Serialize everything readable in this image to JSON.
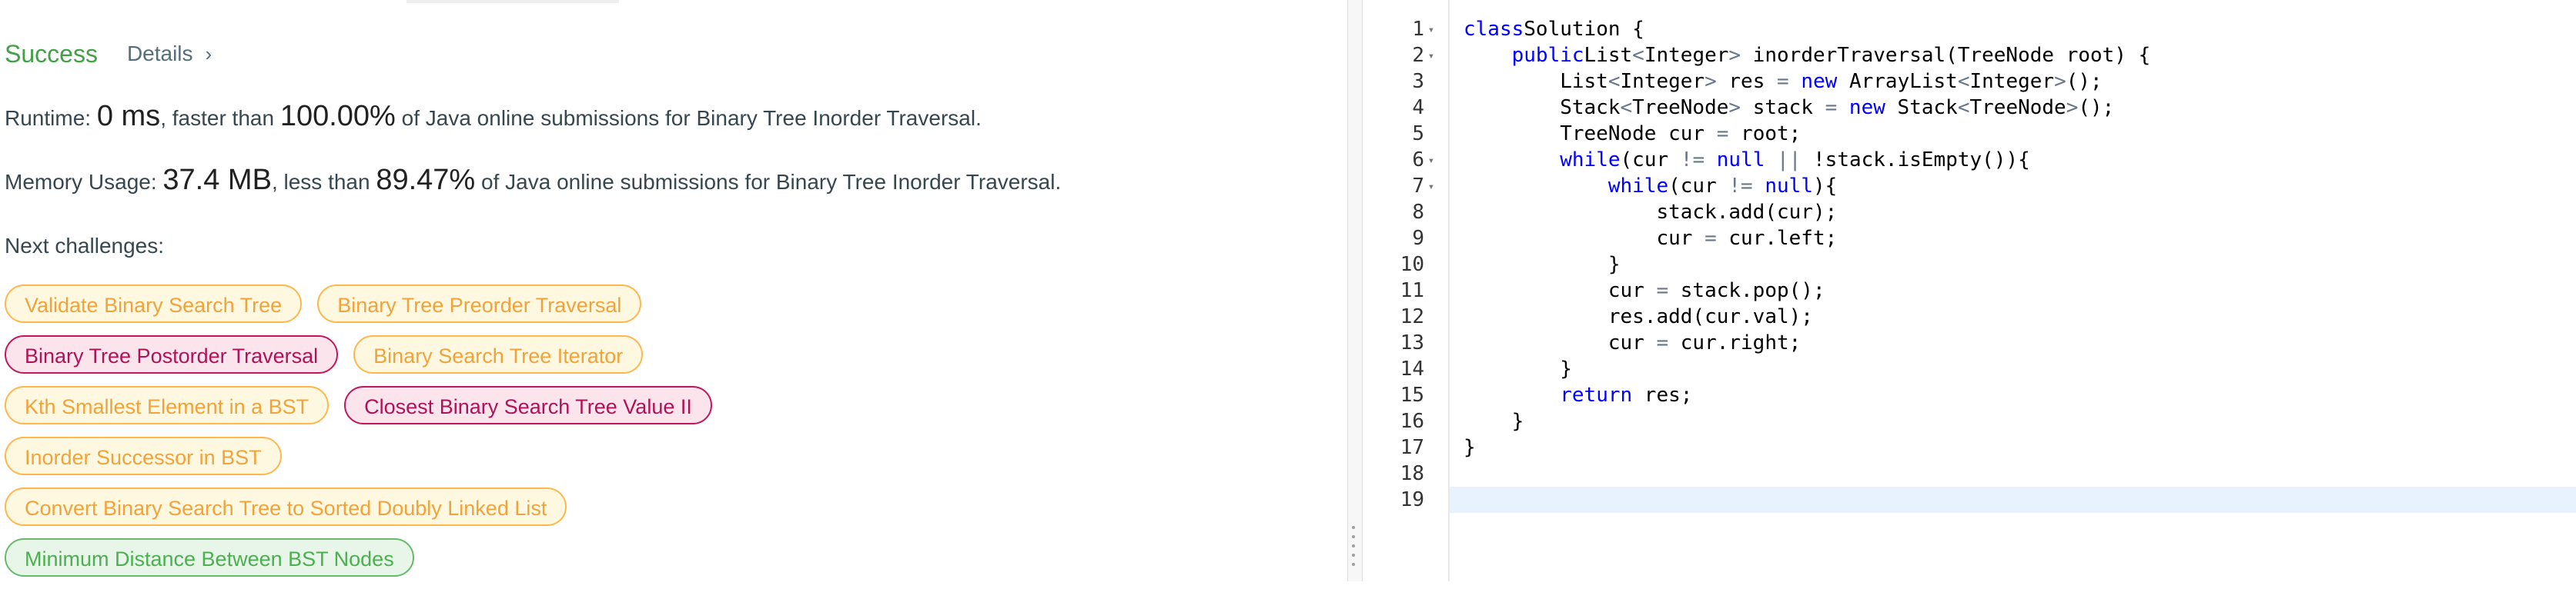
{
  "result": {
    "status": "Success",
    "details_label": "Details",
    "runtime": {
      "label": "Runtime: ",
      "value": "0 ms",
      "comparison": ", faster than ",
      "percent": "100.00%",
      "suffix": " of Java online submissions for Binary Tree Inorder Traversal."
    },
    "memory": {
      "label": "Memory Usage: ",
      "value": "37.4 MB",
      "comparison": ", less than ",
      "percent": "89.47%",
      "suffix": " of Java online submissions for Binary Tree Inorder Traversal."
    }
  },
  "next_challenges": {
    "title": "Next challenges:",
    "rows": [
      [
        {
          "label": "Validate Binary Search Tree",
          "difficulty": "medium"
        },
        {
          "label": "Binary Tree Preorder Traversal",
          "difficulty": "medium"
        }
      ],
      [
        {
          "label": "Binary Tree Postorder Traversal",
          "difficulty": "hard"
        },
        {
          "label": "Binary Search Tree Iterator",
          "difficulty": "medium"
        }
      ],
      [
        {
          "label": "Kth Smallest Element in a BST",
          "difficulty": "medium"
        },
        {
          "label": "Closest Binary Search Tree Value II",
          "difficulty": "hard"
        }
      ],
      [
        {
          "label": "Inorder Successor in BST",
          "difficulty": "medium"
        }
      ],
      [
        {
          "label": "Convert Binary Search Tree to Sorted Doubly Linked List",
          "difficulty": "medium"
        }
      ],
      [
        {
          "label": "Minimum Distance Between BST Nodes",
          "difficulty": "easy"
        }
      ]
    ]
  },
  "editor": {
    "fold_icon": "fold-arrow-icon",
    "lines": [
      {
        "num": "1",
        "fold": true,
        "tokens": [
          [
            "kw",
            "class"
          ],
          [
            "",
            "Solution {"
          ]
        ]
      },
      {
        "num": "2",
        "fold": true,
        "tokens": [
          [
            "",
            "    "
          ],
          [
            "kw",
            "public"
          ],
          [
            "",
            ""
          ],
          [
            "",
            "List"
          ],
          [
            "op",
            "<"
          ],
          [
            "",
            "Integer"
          ],
          [
            "op",
            ">"
          ],
          [
            "",
            " inorderTraversal(TreeNode root) {"
          ]
        ]
      },
      {
        "num": "3",
        "fold": false,
        "tokens": [
          [
            "",
            "        List"
          ],
          [
            "op",
            "<"
          ],
          [
            "",
            "Integer"
          ],
          [
            "op",
            ">"
          ],
          [
            "",
            " res "
          ],
          [
            "op",
            "="
          ],
          [
            "kw",
            " new"
          ],
          [
            "",
            " ArrayList"
          ],
          [
            "op",
            "<"
          ],
          [
            "",
            "Integer"
          ],
          [
            "op",
            ">"
          ],
          [
            "",
            "();"
          ]
        ]
      },
      {
        "num": "4",
        "fold": false,
        "tokens": [
          [
            "",
            "        Stack"
          ],
          [
            "op",
            "<"
          ],
          [
            "",
            "TreeNode"
          ],
          [
            "op",
            ">"
          ],
          [
            "",
            " stack "
          ],
          [
            "op",
            "="
          ],
          [
            "kw",
            " new"
          ],
          [
            "",
            " Stack"
          ],
          [
            "op",
            "<"
          ],
          [
            "",
            "TreeNode"
          ],
          [
            "op",
            ">"
          ],
          [
            "",
            "();"
          ]
        ]
      },
      {
        "num": "5",
        "fold": false,
        "tokens": [
          [
            "",
            "        TreeNode cur "
          ],
          [
            "op",
            "="
          ],
          [
            "",
            " root;"
          ]
        ]
      },
      {
        "num": "6",
        "fold": true,
        "tokens": [
          [
            "",
            "        "
          ],
          [
            "kw",
            "while"
          ],
          [
            "",
            "(cur "
          ],
          [
            "op",
            "!="
          ],
          [
            "kw",
            " null"
          ],
          [
            "op",
            " ||"
          ],
          [
            "",
            " !stack.isEmpty()){"
          ]
        ]
      },
      {
        "num": "7",
        "fold": true,
        "tokens": [
          [
            "",
            "            "
          ],
          [
            "kw",
            "while"
          ],
          [
            "",
            "(cur "
          ],
          [
            "op",
            "!="
          ],
          [
            "kw",
            " null"
          ],
          [
            "",
            "){"
          ]
        ]
      },
      {
        "num": "8",
        "fold": false,
        "tokens": [
          [
            "",
            "                stack.add(cur);"
          ]
        ]
      },
      {
        "num": "9",
        "fold": false,
        "tokens": [
          [
            "",
            "                cur "
          ],
          [
            "op",
            "="
          ],
          [
            "",
            " cur.left;"
          ]
        ]
      },
      {
        "num": "10",
        "fold": false,
        "tokens": [
          [
            "",
            "            }"
          ]
        ]
      },
      {
        "num": "11",
        "fold": false,
        "tokens": [
          [
            "",
            "            cur "
          ],
          [
            "op",
            "="
          ],
          [
            "",
            " stack.pop();"
          ]
        ]
      },
      {
        "num": "12",
        "fold": false,
        "tokens": [
          [
            "",
            "            res.add(cur.val);"
          ]
        ]
      },
      {
        "num": "13",
        "fold": false,
        "tokens": [
          [
            "",
            "            cur "
          ],
          [
            "op",
            "="
          ],
          [
            "",
            " cur.right;"
          ]
        ]
      },
      {
        "num": "14",
        "fold": false,
        "tokens": [
          [
            "",
            "        }"
          ]
        ]
      },
      {
        "num": "15",
        "fold": false,
        "tokens": [
          [
            "",
            "        "
          ],
          [
            "kw",
            "return"
          ],
          [
            "",
            " res;"
          ]
        ]
      },
      {
        "num": "16",
        "fold": false,
        "tokens": [
          [
            "",
            "    }"
          ]
        ]
      },
      {
        "num": "17",
        "fold": false,
        "tokens": [
          [
            "",
            "}"
          ]
        ]
      },
      {
        "num": "18",
        "fold": false,
        "tokens": []
      },
      {
        "num": "19",
        "fold": false,
        "tokens": [],
        "active": true
      }
    ]
  }
}
